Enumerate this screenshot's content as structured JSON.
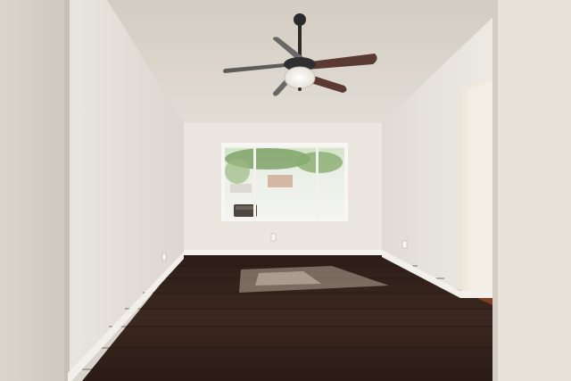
{
  "scene": {
    "subject": "empty room",
    "objects": [
      "ceiling-fan",
      "light-fixture",
      "window",
      "patio-chair",
      "hardwood-floor",
      "baseboard",
      "doorway",
      "electrical-outlet"
    ]
  },
  "colors": {
    "ceiling": "#dcd6cc",
    "back_wall": "#ece8e1",
    "left_wall": "#e4dfd8",
    "right_wall": "#e8e4dd",
    "floor_dark": "#2a1b14",
    "floor_mid": "#3a271d",
    "baseboard": "#f5f3ee",
    "fan_blade": "#5a3a32",
    "fan_metal": "#2b2b2b"
  }
}
